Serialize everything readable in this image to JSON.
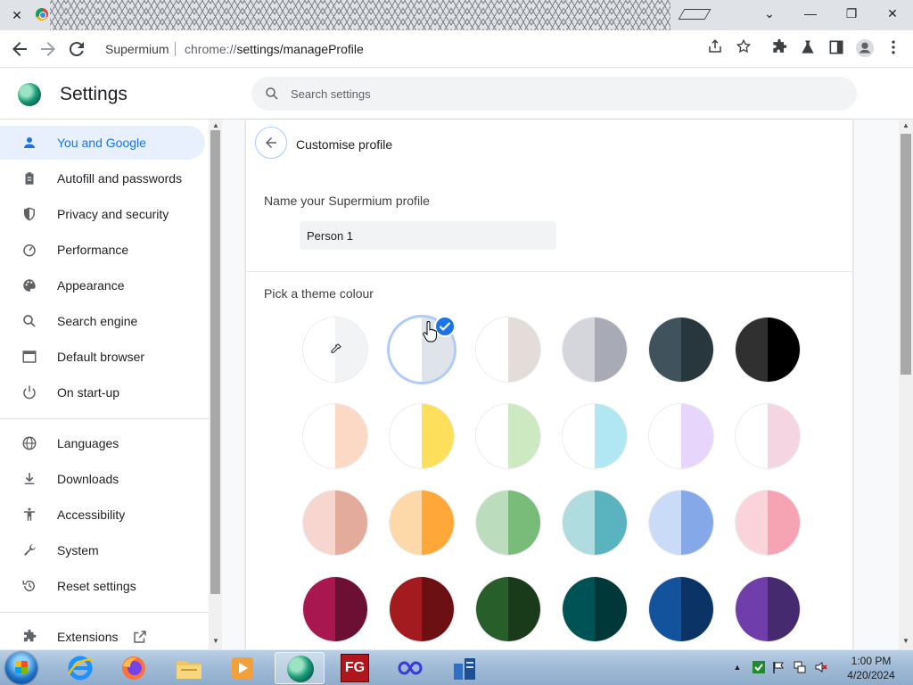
{
  "browser": {
    "tab_close": "✕",
    "window_controls": {
      "minimize": "—",
      "maximize": "❐",
      "close": "✕",
      "dropdown": "⌄"
    },
    "omnibox": {
      "site": "Supermium",
      "url_scheme": "chrome://",
      "url_path": "settings/manageProfile"
    }
  },
  "header": {
    "title": "Settings",
    "search_placeholder": "Search settings"
  },
  "sidebar": {
    "items": [
      {
        "label": "You and Google",
        "icon": "person-icon",
        "active": true
      },
      {
        "label": "Autofill and passwords",
        "icon": "clipboard-icon"
      },
      {
        "label": "Privacy and security",
        "icon": "shield-icon"
      },
      {
        "label": "Performance",
        "icon": "speedometer-icon"
      },
      {
        "label": "Appearance",
        "icon": "palette-icon"
      },
      {
        "label": "Search engine",
        "icon": "search-icon"
      },
      {
        "label": "Default browser",
        "icon": "browser-window-icon"
      },
      {
        "label": "On start-up",
        "icon": "power-icon"
      },
      {
        "label": "Languages",
        "icon": "globe-icon"
      },
      {
        "label": "Downloads",
        "icon": "download-icon"
      },
      {
        "label": "Accessibility",
        "icon": "accessibility-icon"
      },
      {
        "label": "System",
        "icon": "wrench-icon"
      },
      {
        "label": "Reset settings",
        "icon": "history-icon"
      },
      {
        "label": "Extensions",
        "icon": "puzzle-icon"
      }
    ]
  },
  "profile": {
    "title": "Customise profile",
    "name_label": "Name your Supermium profile",
    "name_value": "Person 1",
    "theme_label": "Pick a theme colour"
  },
  "theme_colors": [
    {
      "left": "#ffffff",
      "right": "#f1f3f4",
      "custom": true
    },
    {
      "left": "#ffffff",
      "right": "#dfe3ea",
      "selected": true
    },
    {
      "left": "#ffffff",
      "right": "#e3dcd8"
    },
    {
      "left": "#d4d6dc",
      "right": "#a8abb5"
    },
    {
      "left": "#40525c",
      "right": "#28373d"
    },
    {
      "left": "#303030",
      "right": "#000000"
    },
    {
      "left": "#ffffff",
      "right": "#fcd9c5"
    },
    {
      "left": "#ffffff",
      "right": "#fddf5c"
    },
    {
      "left": "#ffffff",
      "right": "#cce9c2"
    },
    {
      "left": "#ffffff",
      "right": "#b1e7f2"
    },
    {
      "left": "#ffffff",
      "right": "#e8d5fb"
    },
    {
      "left": "#ffffff",
      "right": "#f5d5e2"
    },
    {
      "left": "#f6d6cf",
      "right": "#e2ab9b"
    },
    {
      "left": "#fdd9a9",
      "right": "#ffa83a"
    },
    {
      "left": "#bcdcbe",
      "right": "#79bb79"
    },
    {
      "left": "#aedcdf",
      "right": "#5ab4bf"
    },
    {
      "left": "#c9dbf7",
      "right": "#84a8e8"
    },
    {
      "left": "#fbd3da",
      "right": "#f6a4b4"
    },
    {
      "left": "#a81750",
      "right": "#6b0f33"
    },
    {
      "left": "#a41b1f",
      "right": "#6d1013"
    },
    {
      "left": "#275e29",
      "right": "#1a3b1a"
    },
    {
      "left": "#005354",
      "right": "#003839"
    },
    {
      "left": "#13529c",
      "right": "#0c3366"
    },
    {
      "left": "#703eaa",
      "right": "#462a70"
    }
  ],
  "colors": {
    "accent": "#1a73e8",
    "active_nav_bg": "#e8f0fe"
  },
  "taskbar": {
    "clock_time": "1:00 PM",
    "clock_date": "4/20/2024",
    "apps": [
      "ie-icon",
      "firefox-icon",
      "explorer-icon",
      "media-player-icon",
      "supermium-icon",
      "fg-icon",
      "infinity-icon",
      "server-icon"
    ],
    "fg_label": "FG"
  }
}
